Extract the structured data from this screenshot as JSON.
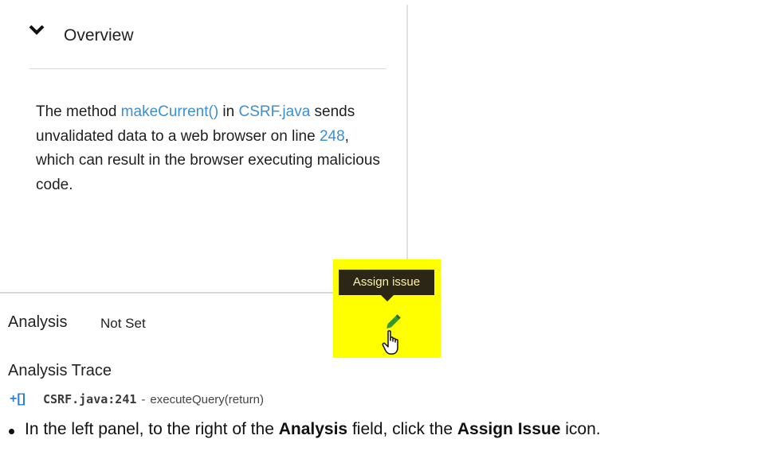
{
  "overview": {
    "title": "Overview",
    "description": {
      "part1": "The method ",
      "method_link": "makeCurrent()",
      "part2": " in ",
      "file_link": "CSRF.java",
      "part3": " sends unvalidated data to a web browser on line ",
      "line_link": "248",
      "part4": ", which can result in the browser executing malicious code."
    }
  },
  "tooltip": {
    "label": "Assign issue"
  },
  "analysis": {
    "label": "Analysis",
    "value": "Not Set"
  },
  "trace": {
    "title": "Analysis Trace",
    "items": [
      {
        "icon": "return-arrow-icon",
        "glyph": "+[]",
        "file": "CSRF.java:241",
        "sep": "-",
        "call": "executeQuery(return)"
      }
    ]
  },
  "instruction": {
    "part1": "In the left panel, to the right of the ",
    "bold1": "Analysis",
    "part2": " field, click the ",
    "bold2": "Assign Issue",
    "part3": " icon."
  },
  "colors": {
    "link": "#3d8fd1",
    "highlight": "#ffff00",
    "tooltip_bg": "#2b2616",
    "pencil": "#2e9a2e"
  }
}
